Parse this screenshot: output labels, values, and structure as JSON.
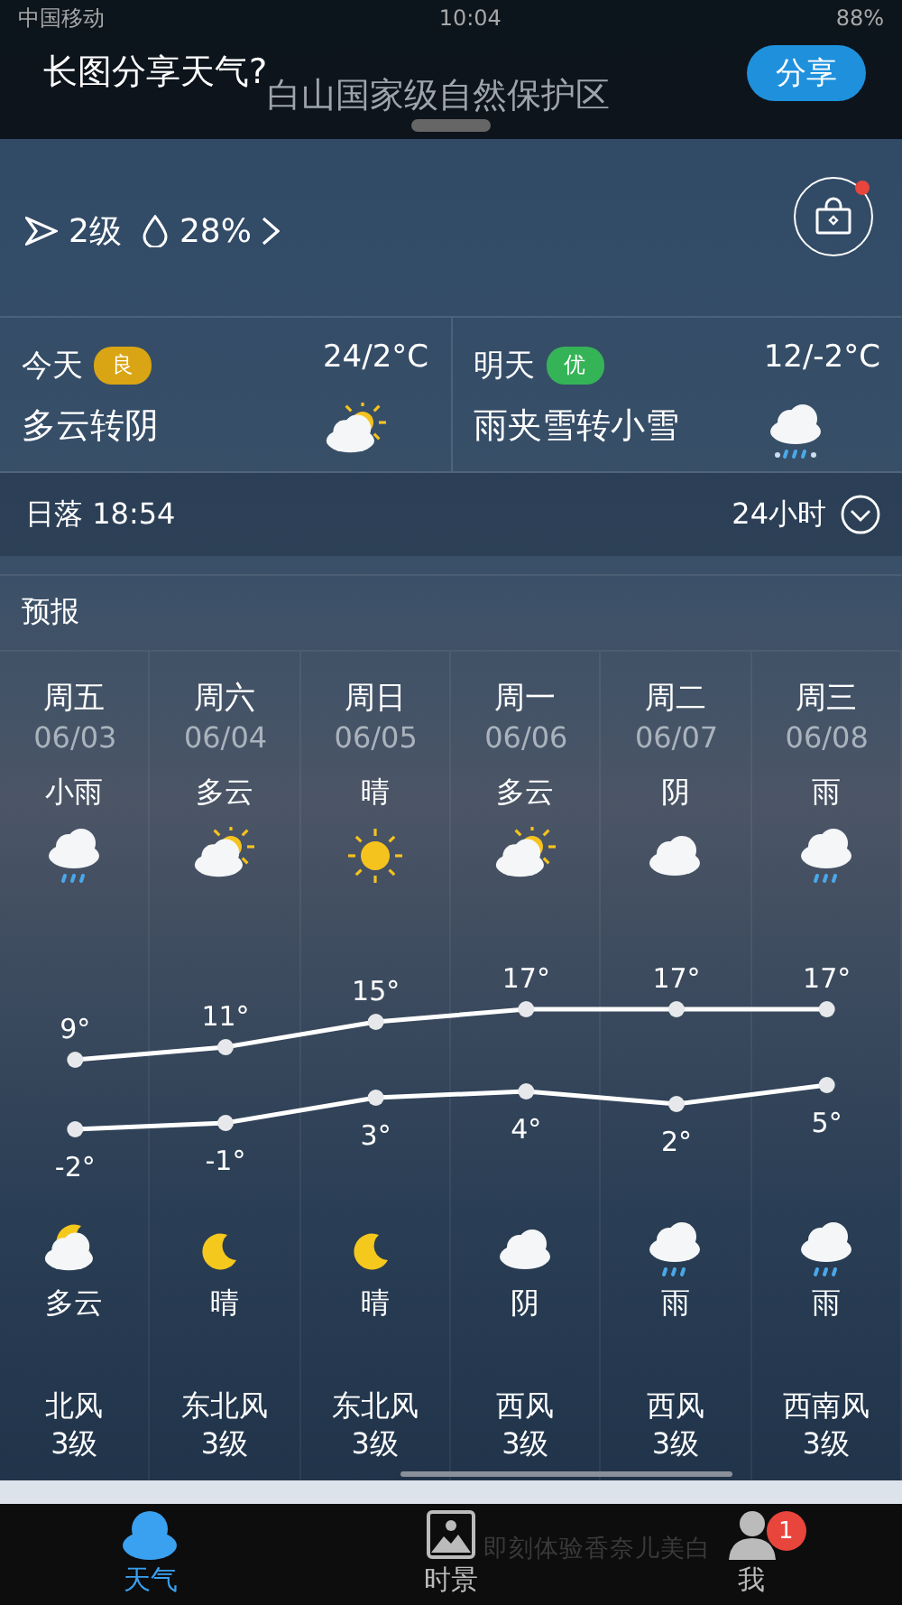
{
  "status_bar": {
    "carrier": "中国移动",
    "time": "10:04",
    "battery": "88%"
  },
  "share_banner": {
    "prompt": "长图分享天气?",
    "button": "分享"
  },
  "header": {
    "location": "白山国家级自然保护区",
    "wind": "2级",
    "humidity": "28%",
    "shop_badge": true
  },
  "summary": [
    {
      "label": "今天",
      "aqi": "良",
      "color": "#d9a514",
      "temp": "24/2°C",
      "desc": "多云转阴",
      "kind": "partly"
    },
    {
      "label": "明天",
      "aqi": "优",
      "color": "#35b457",
      "temp": "12/-2°C",
      "desc": "雨夹雪转小雪",
      "kind": "sleet"
    }
  ],
  "sun_row": {
    "sunset": "日落 18:54",
    "hours": "24小时"
  },
  "forecast": {
    "title": "预报",
    "days": [
      {
        "day": "周五",
        "day_weather": {
          "text": "小雨",
          "kind": "rain"
        },
        "night_weather": {
          "text": "多云",
          "kind": "mooncloud"
        },
        "wind": "北风",
        "wind_level": "3级"
      },
      {
        "day": "周六",
        "day_weather": {
          "text": "多云",
          "kind": "partly"
        },
        "night_weather": {
          "text": "晴",
          "kind": "moon"
        },
        "wind": "东北风",
        "wind_level": "3级"
      },
      {
        "day": "周日",
        "day_weather": {
          "text": "晴",
          "kind": "sun"
        },
        "night_weather": {
          "text": "晴",
          "kind": "moon"
        },
        "wind": "东北风",
        "wind_level": "3级"
      },
      {
        "day": "周一",
        "day_weather": {
          "text": "多云",
          "kind": "partly"
        },
        "night_weather": {
          "text": "阴",
          "kind": "cloud"
        },
        "wind": "西风",
        "wind_level": "3级"
      },
      {
        "day": "周二",
        "day_weather": {
          "text": "阴",
          "kind": "cloud"
        },
        "night_weather": {
          "text": "雨",
          "kind": "rain"
        },
        "wind": "西风",
        "wind_level": "3级"
      },
      {
        "day": "周三",
        "day_weather": {
          "text": "雨",
          "kind": "rain"
        },
        "night_weather": {
          "text": "雨",
          "kind": "rain"
        },
        "wind": "西南风",
        "wind_level": "3级"
      }
    ],
    "chart_data": {
      "type": "line",
      "categories": [
        "06/03",
        "06/04",
        "06/05",
        "06/06",
        "06/07",
        "06/08"
      ],
      "series": [
        {
          "color": "#ffffff",
          "marker": "o",
          "values": [
            9,
            11,
            15,
            17,
            17,
            17
          ],
          "value_labels": [
            "9°",
            "11°",
            "15°",
            "17°",
            "17°",
            "17°"
          ]
        },
        {
          "color": "#ffffff",
          "marker": "o",
          "values": [
            -2,
            -1,
            3,
            4,
            2,
            5
          ],
          "value_labels": [
            "-2°",
            "-1°",
            "3°",
            "4°",
            "2°",
            "5°"
          ]
        }
      ]
    }
  },
  "ad": {
    "text": "即刻体验香奈儿美白"
  },
  "tab_bar": [
    {
      "label": "天气",
      "selected": true
    },
    {
      "label": "时景",
      "selected": false
    },
    {
      "label": "我",
      "selected": false,
      "badge": "1"
    }
  ]
}
